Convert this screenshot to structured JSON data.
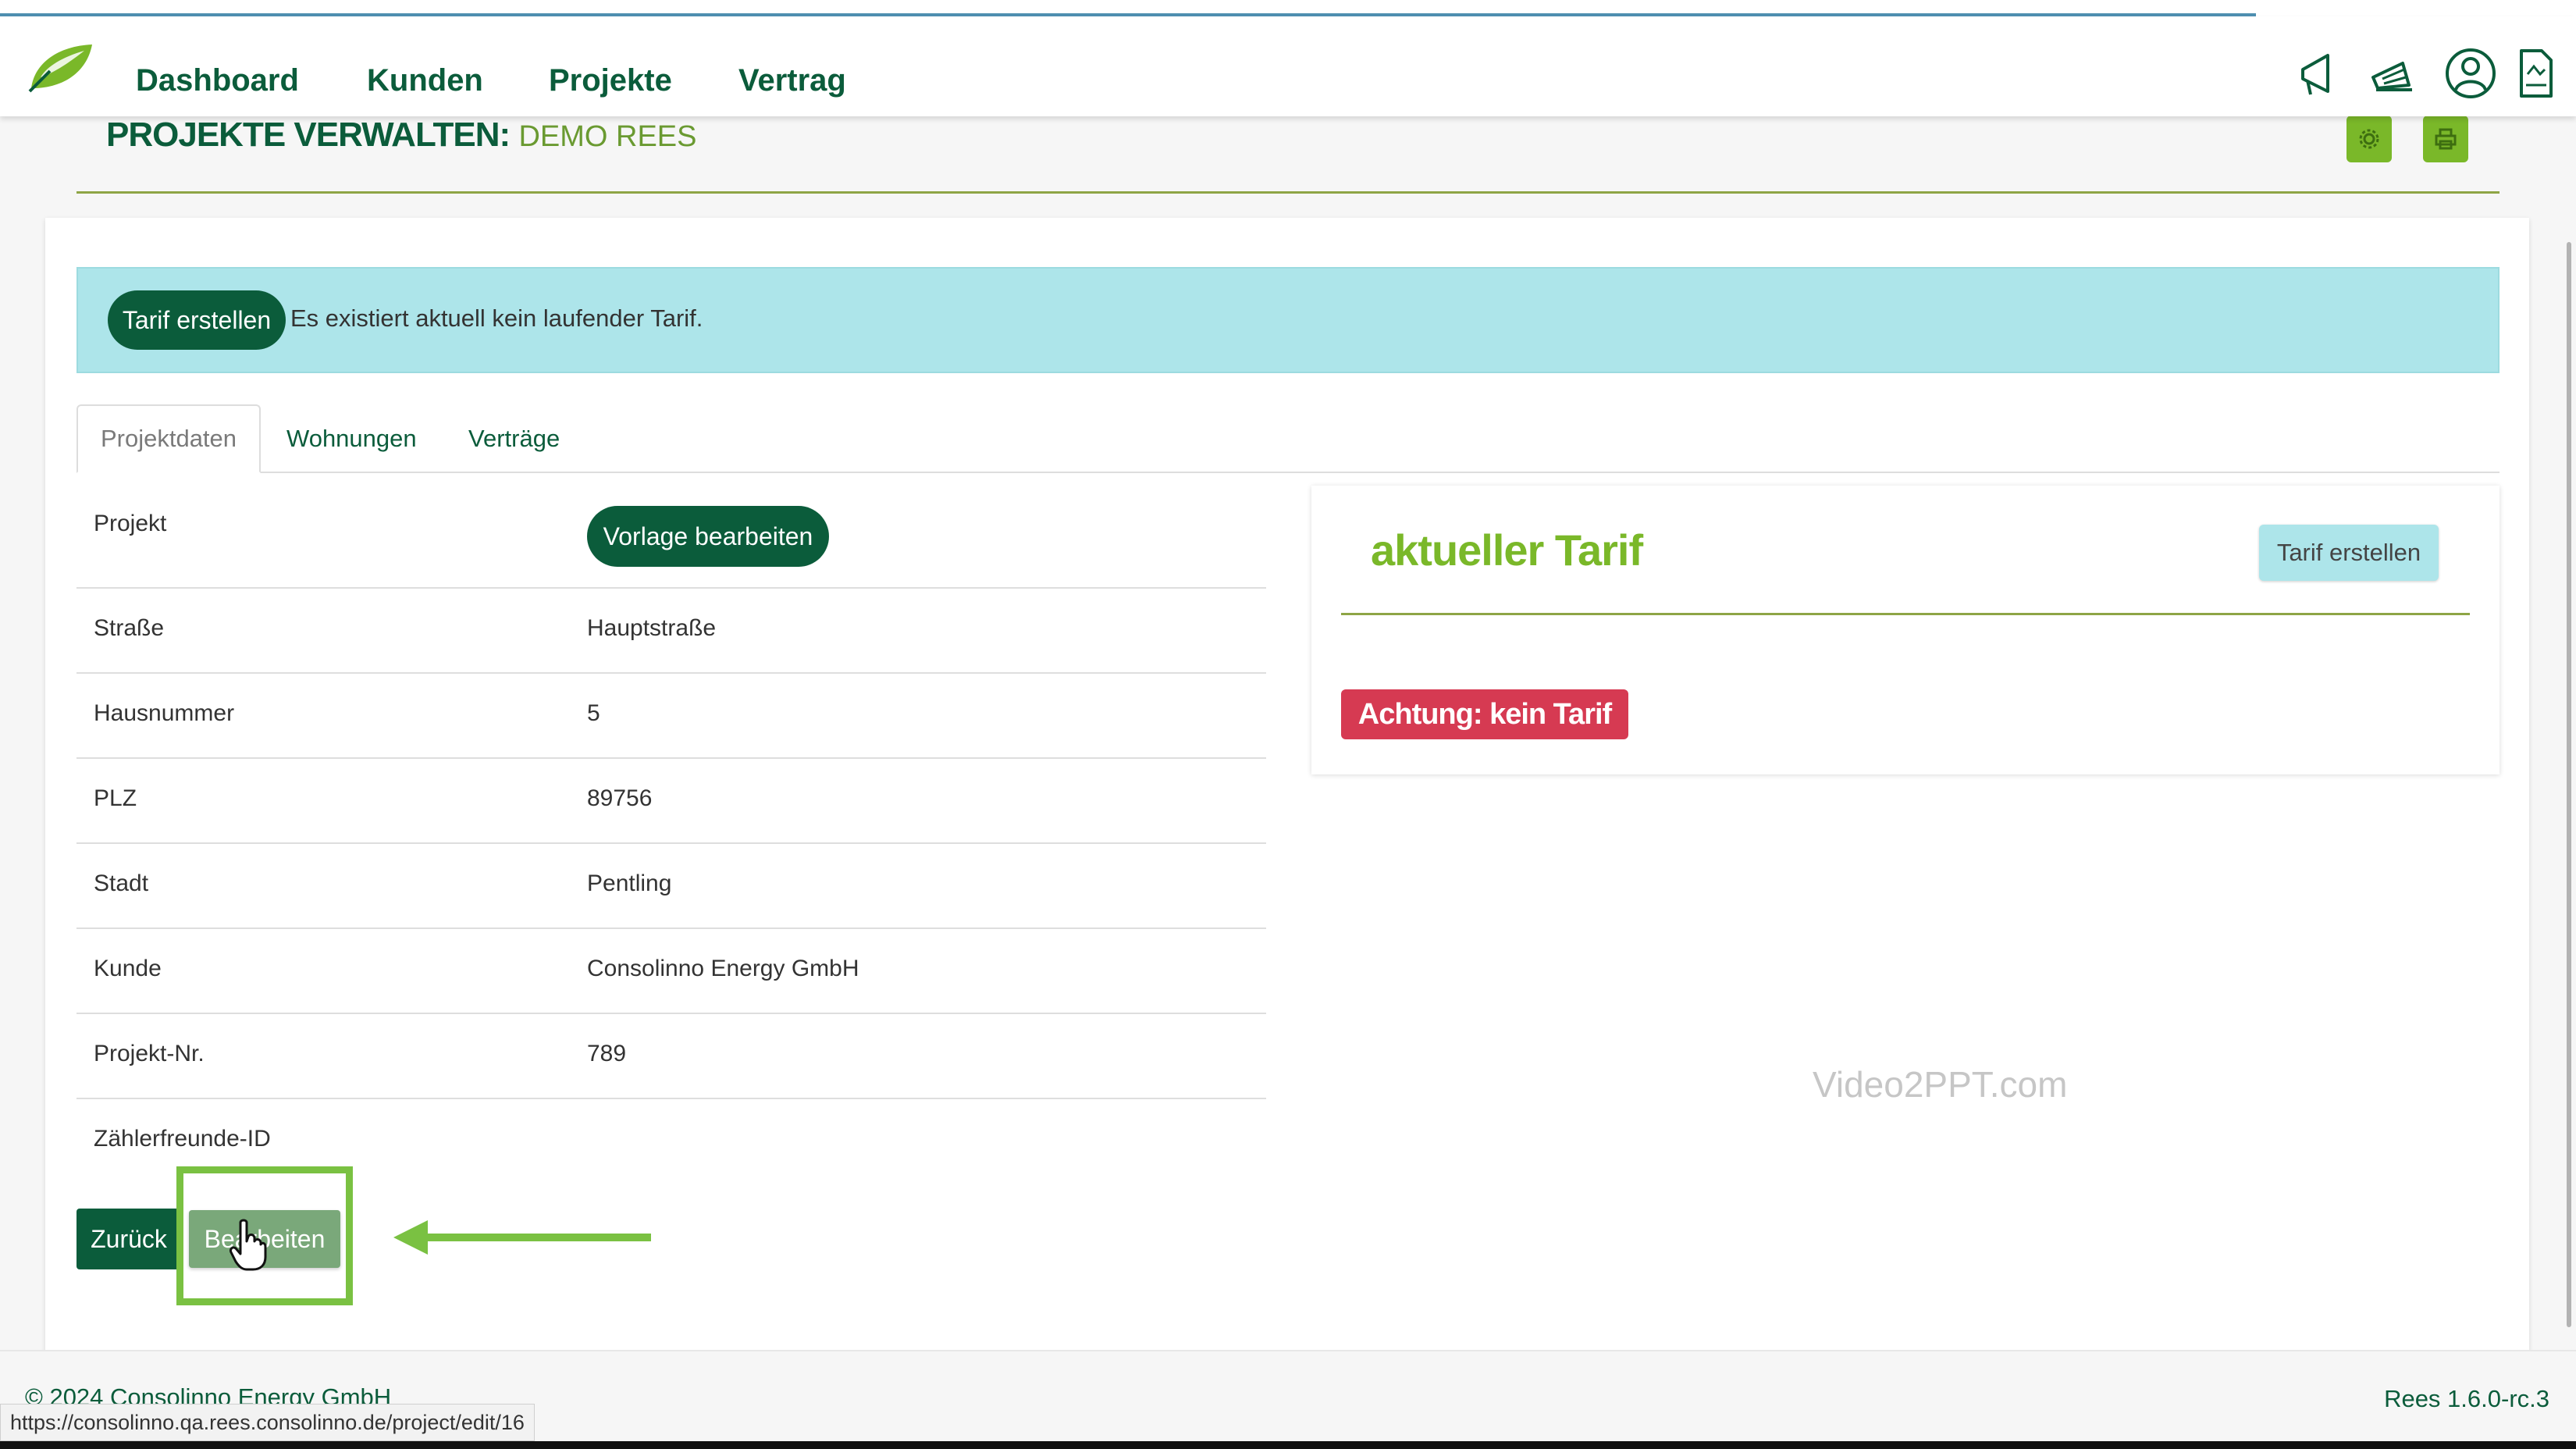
{
  "nav": {
    "items": [
      "Dashboard",
      "Kunden",
      "Projekte",
      "Vertrag"
    ]
  },
  "header": {
    "title": "PROJEKTE VERWALTEN:",
    "subtitle": "DEMO REES"
  },
  "alert": {
    "button_label": "Tarif erstellen",
    "message": "Es existiert aktuell kein laufender Tarif."
  },
  "tabs": [
    "Projektdaten",
    "Wohnungen",
    "Verträge"
  ],
  "project": {
    "template_button": "Vorlage bearbeiten",
    "rows": [
      {
        "label": "Projekt",
        "value": ""
      },
      {
        "label": "Straße",
        "value": "Hauptstraße"
      },
      {
        "label": "Hausnummer",
        "value": "5"
      },
      {
        "label": "PLZ",
        "value": "89756"
      },
      {
        "label": "Stadt",
        "value": "Pentling"
      },
      {
        "label": "Kunde",
        "value": "Consolinno Energy GmbH"
      },
      {
        "label": "Projekt-Nr.",
        "value": "789"
      },
      {
        "label": "Zählerfreunde-ID",
        "value": ""
      }
    ]
  },
  "tarif": {
    "title": "aktueller Tarif",
    "create_label": "Tarif erstellen",
    "warning": "Achtung: kein Tarif"
  },
  "watermark": "Video2PPT.com",
  "actions": {
    "back": "Zurück",
    "edit": "Bearbeiten"
  },
  "footer": {
    "copyright": "© 2024 Consolinno Energy GmbH",
    "version": "Rees 1.6.0-rc.3"
  },
  "status_url": "https://consolinno.qa.rees.consolinno.de/project/edit/16",
  "icons": {
    "logo": "leaf-logo-icon",
    "nav": [
      "megaphone-icon",
      "announcement-icon",
      "user-account-icon",
      "document-icon"
    ],
    "header": [
      "gear-icon",
      "print-icon"
    ],
    "pointer": "hand-cursor-icon",
    "annotation": "arrow-left-icon"
  },
  "colors": {
    "primary": "#0b5c3b",
    "accent": "#7ab829",
    "info": "#ade5ea",
    "danger": "#d63a52"
  }
}
